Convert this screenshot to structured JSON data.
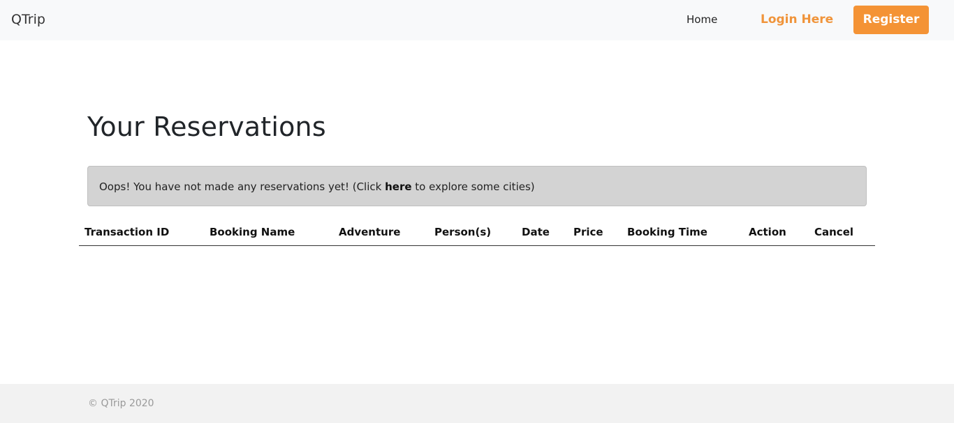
{
  "navbar": {
    "brand": "QTrip",
    "home_label": "Home",
    "login_label": "Login Here",
    "register_label": "Register"
  },
  "main": {
    "title": "Your Reservations",
    "alert": {
      "prefix": "Oops! You have not made any reservations yet! (Click ",
      "link_text": "here",
      "suffix": " to explore some cities)"
    },
    "table": {
      "headers": [
        "Transaction ID",
        "Booking Name",
        "Adventure",
        "Person(s)",
        "Date",
        "Price",
        "Booking Time",
        "Action",
        "Cancel"
      ]
    }
  },
  "footer": {
    "text": "© QTrip 2020"
  },
  "colors": {
    "accent": "#f49335",
    "navbar_bg": "#f8f9fa",
    "alert_bg": "#d3d3d3",
    "footer_bg": "#f2f2f2"
  }
}
